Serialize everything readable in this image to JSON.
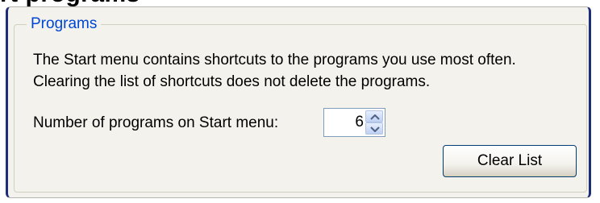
{
  "window": {
    "partial_heading": "rt programs"
  },
  "programs_group": {
    "title": "Programs",
    "description_line1": "The Start menu contains shortcuts to the programs you use most often.",
    "description_line2": "Clearing the list of shortcuts does not delete the programs.",
    "count_label": "Number of programs on Start menu:",
    "count_value": "6",
    "spin_up_icon": "arrow-up-icon",
    "spin_down_icon": "arrow-down-icon",
    "clear_button_label": "Clear List"
  },
  "colors": {
    "panel_background": "#f3f2ec",
    "group_title": "#0046d5",
    "window_frame": "#1e2d7a",
    "button_border": "#003c74",
    "field_border": "#7f9db9"
  }
}
